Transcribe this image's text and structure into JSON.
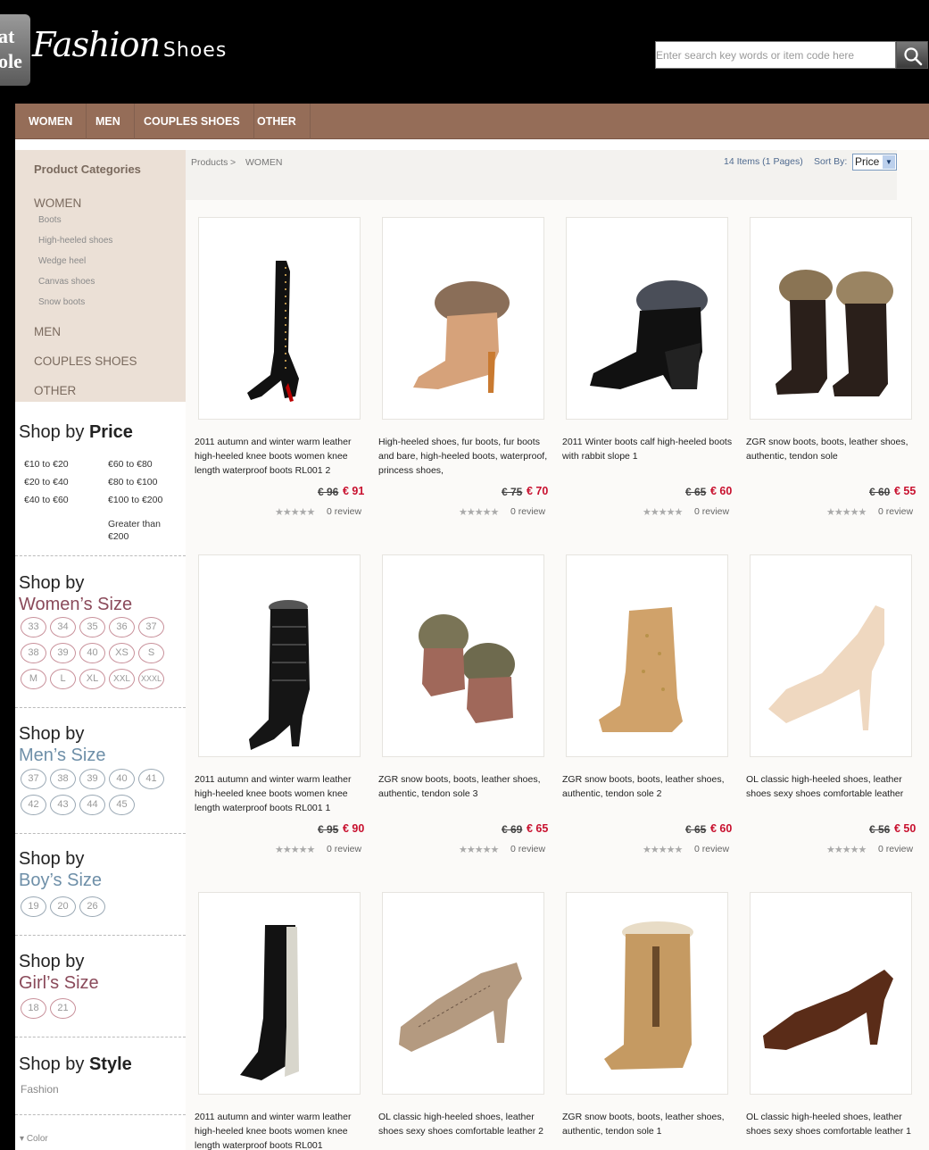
{
  "header": {
    "badge_line1": "at",
    "badge_line2": "ole",
    "logo_script": "Fashion",
    "logo_plain": "Shoes",
    "search_placeholder": "Enter search key words or item code here"
  },
  "nav": [
    "WOMEN",
    "MEN",
    "COUPLES SHOES",
    "OTHER"
  ],
  "sidebar": {
    "categories_title": "Product Categories",
    "women": "WOMEN",
    "women_subs": [
      "Boots",
      "High-heeled shoes",
      "Wedge heel",
      "Canvas shoes",
      "Snow boots"
    ],
    "men": "MEN",
    "couples": "COUPLES SHOES",
    "other": "OTHER",
    "price_head": {
      "pre": "Shop by",
      "b": "Price"
    },
    "price_links": [
      "€10 to €20",
      "€60 to €80",
      "€20 to €40",
      "€80 to €100",
      "€40 to €60",
      "€100 to €200",
      "Greater than",
      "€200"
    ],
    "women_size_head": {
      "pre": "Shop by",
      "b": "Women’s Size"
    },
    "women_sizes": [
      "33",
      "34",
      "35",
      "36",
      "37",
      "38",
      "39",
      "40",
      "XS",
      "S",
      "M",
      "L",
      "XL",
      "XXL",
      "XXXL"
    ],
    "men_size_head": {
      "pre": "Shop by",
      "b": "Men’s Size"
    },
    "men_sizes": [
      "37",
      "38",
      "39",
      "40",
      "41",
      "42",
      "43",
      "44",
      "45"
    ],
    "boy_size_head": {
      "pre": "Shop by",
      "b": "Boy’s Size"
    },
    "boy_sizes": [
      "19",
      "20",
      "26"
    ],
    "girl_size_head": {
      "pre": "Shop by",
      "b": "Girl’s Size"
    },
    "girl_sizes": [
      "18",
      "21"
    ],
    "style_head": {
      "pre": "Shop by",
      "b": "Style"
    },
    "style_links": [
      "Fashion"
    ],
    "color_toggle": "Color"
  },
  "toolbar": {
    "crumb_products": "Products",
    "crumb_sep": ">",
    "crumb_current": "WOMEN",
    "item_count": "14 Items (1 Pages)",
    "sort_label": "Sort By:",
    "sort_value": "Price"
  },
  "products": [
    {
      "title": "2011 autumn and winter warm leather high-heeled knee boots women knee length waterproof boots RL001 2",
      "old": "€ 96",
      "new": "€ 91",
      "review": "0 review",
      "icon": "thigh-boot-icon"
    },
    {
      "title": "High-heeled shoes, fur boots, fur boots and bare, high-heeled boots, waterproof, princess shoes,",
      "old": "€ 75",
      "new": "€ 70",
      "review": "0 review",
      "icon": "fur-bootie-icon"
    },
    {
      "title": "2011 Winter boots calf high-heeled boots with rabbit slope 1",
      "old": "€ 65",
      "new": "€ 60",
      "review": "0 review",
      "icon": "wedge-bootie-icon"
    },
    {
      "title": "ZGR snow boots, boots, leather shoes, authentic, tendon sole",
      "old": "€ 60",
      "new": "€ 55",
      "review": "0 review",
      "icon": "fur-snow-boot-icon"
    },
    {
      "title": "2011 autumn and winter warm leather high-heeled knee boots women knee length waterproof boots RL001 1",
      "old": "€ 95",
      "new": "€ 90",
      "review": "0 review",
      "icon": "knee-boot-icon"
    },
    {
      "title": "ZGR snow boots, boots, leather shoes, authentic, tendon sole 3",
      "old": "€ 69",
      "new": "€ 65",
      "review": "0 review",
      "icon": "fur-slipper-icon"
    },
    {
      "title": "ZGR snow boots, boots, leather shoes, authentic, tendon sole 2",
      "old": "€ 65",
      "new": "€ 60",
      "review": "0 review",
      "icon": "tan-snow-boot-icon"
    },
    {
      "title": "OL classic high-heeled shoes, leather shoes sexy shoes comfortable leather",
      "old": "€ 56",
      "new": "€ 50",
      "review": "0 review",
      "icon": "nude-pump-icon"
    },
    {
      "title": "2011 autumn and winter warm leather high-heeled knee boots women knee length waterproof boots RL001",
      "old": "",
      "new": "",
      "review": "",
      "icon": "black-knee-boot-icon"
    },
    {
      "title": "OL classic high-heeled shoes, leather shoes sexy shoes comfortable leather 2",
      "old": "",
      "new": "",
      "review": "",
      "icon": "snakeskin-pump-icon"
    },
    {
      "title": "ZGR snow boots, boots, leather shoes, authentic, tendon sole 1",
      "old": "",
      "new": "",
      "review": "",
      "icon": "toggle-snow-boot-icon"
    },
    {
      "title": "OL classic high-heeled shoes, leather shoes sexy shoes comfortable leather 1",
      "old": "",
      "new": "",
      "review": "",
      "icon": "brown-pump-icon"
    }
  ]
}
